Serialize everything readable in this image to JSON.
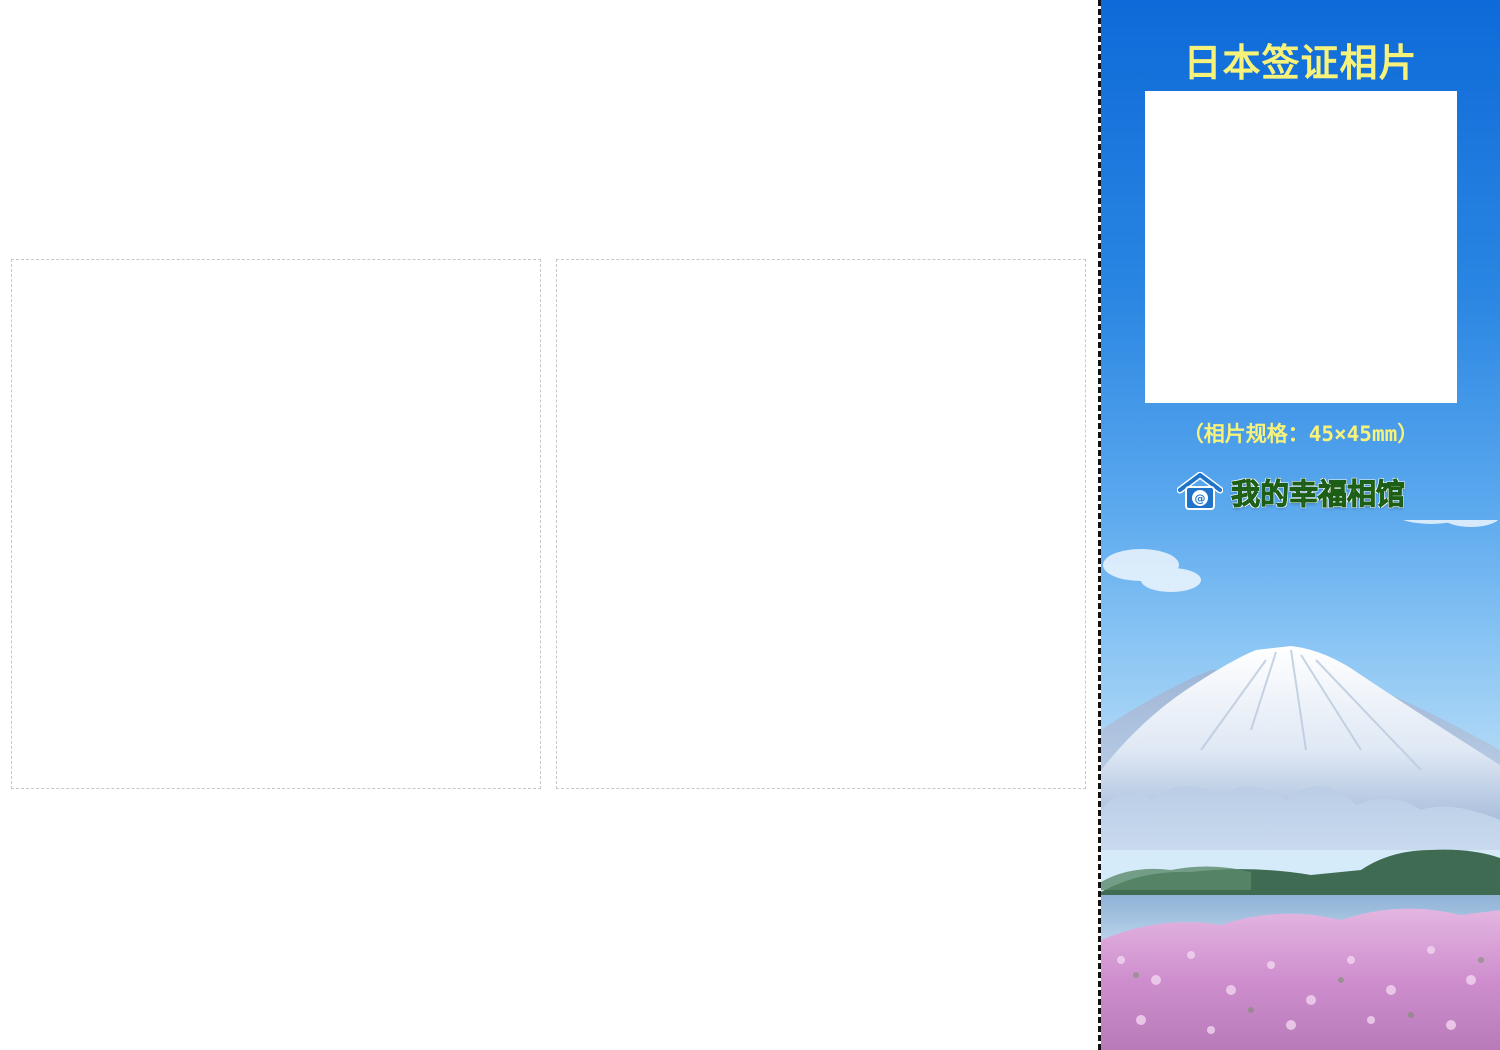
{
  "layout_sheet": {
    "photo_slots": [
      {
        "name": "photo-slot-left"
      },
      {
        "name": "photo-slot-right"
      }
    ]
  },
  "panel": {
    "title": "日本签证相片",
    "photo_spec": "（相片规格：45×45mm）",
    "studio_name": "我的幸福相馆",
    "studio_icon": "house-at-icon",
    "colors": {
      "title_text": "#f6f27a",
      "sky_top": "#0e6ad8",
      "studio_green": "#2d8a24",
      "flowers": "#d9a0d8"
    }
  }
}
